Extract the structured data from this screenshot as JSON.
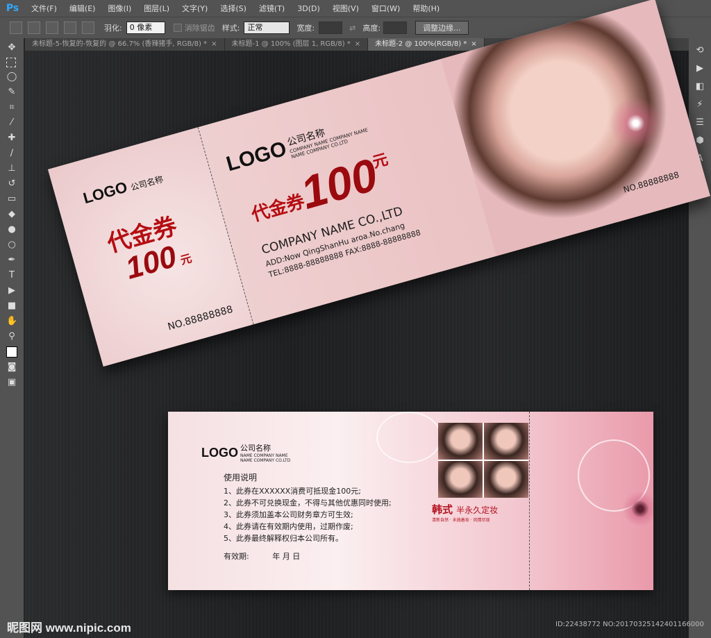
{
  "app": {
    "logo": "Ps"
  },
  "menu": [
    "文件(F)",
    "编辑(E)",
    "图像(I)",
    "图层(L)",
    "文字(Y)",
    "选择(S)",
    "滤镜(T)",
    "3D(D)",
    "视图(V)",
    "窗口(W)",
    "帮助(H)"
  ],
  "options": {
    "feather_label": "羽化:",
    "feather_value": "0 像素",
    "antialias_label": "消除锯齿",
    "style_label": "样式:",
    "style_value": "正常",
    "width_label": "宽度:",
    "height_label": "高度:",
    "refine_button": "调整边缘..."
  },
  "tabs": [
    {
      "label": "未标题-5-恢复的-恢复的 @ 66.7% (香辣猪手, RGB/8) *",
      "close": "×"
    },
    {
      "label": "未标题-1 @ 100% (图层 1, RGB/8) *",
      "close": "×"
    },
    {
      "label": "未标题-2 @ 100%(RGB/8) *",
      "close": "×"
    }
  ],
  "voucher_front": {
    "stub_logo": "LOGO",
    "stub_company": "公司名称",
    "stub_title": "代金券",
    "stub_amount": "100",
    "stub_unit": "元",
    "stub_no": "NO.88888888",
    "logo": "LOGO",
    "company_cn": "公司名称",
    "company_en1": "COMPANY NAME COMPANY NAME",
    "company_en2": "NAME COMPANY CO.LTD",
    "title": "代金券",
    "amount": "100",
    "unit": "元",
    "company_name": "COMPANY NAME CO.,LTD",
    "add": "ADD:Now QingShanHu aroa.No.chang",
    "tel": "TEL:8888-88888888   FAX:8888-88888888",
    "no": "NO.88888888"
  },
  "voucher_back": {
    "logo": "LOGO",
    "company_cn": "公司名称",
    "company_en1": "NAME COMPANY NAME",
    "company_en2": "NAME COMPANY CO.LTD",
    "rules_title": "使用说明",
    "rules": [
      "1、此券在XXXXXX消费可抵现金100元;",
      "2、此券不可兑换现金，不得与其他优惠同时使用;",
      "3、此券须加盖本公司财务章方可生效;",
      "4、此券请在有效期内使用，过期作废;",
      "5、此券最终解释权归本公司所有。"
    ],
    "validity_label": "有效期:",
    "validity_ymd": "年    月    日",
    "brand_big": "韩式",
    "brand_rest": "半永久定妆",
    "brand_small": "清新自然 · 未施着妆 · 风情尽现"
  },
  "watermark": {
    "site": "昵图网 www.nipic.com",
    "id": "ID:22438772 NO:20170325142401166000"
  }
}
